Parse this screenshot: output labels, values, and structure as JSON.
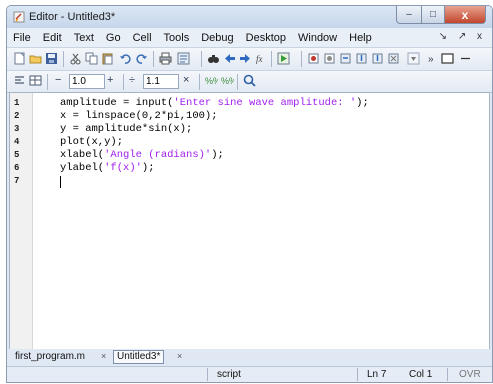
{
  "window": {
    "title": "Editor - Untitled3*",
    "controls": {
      "minimize": "–",
      "maximize": "□",
      "close": "x"
    }
  },
  "menu": {
    "items": [
      "File",
      "Edit",
      "Text",
      "Go",
      "Cell",
      "Tools",
      "Debug",
      "Desktop",
      "Window",
      "Help"
    ],
    "right_controls": "↘ ↗ x"
  },
  "toolbar2": {
    "minus_label": "−",
    "value1": "1.0",
    "plus_label": "+",
    "divide_label": "÷",
    "value2": "1.1",
    "times_label": "×"
  },
  "editor": {
    "line_numbers": [
      "1",
      "2",
      "3",
      "4",
      "5",
      "6",
      "7"
    ],
    "lines": [
      {
        "pre": "amplitude = input(",
        "str": "'Enter sine wave amplitude: '",
        "post": ");"
      },
      {
        "pre": "x = linspace(0,2*pi,100);",
        "str": "",
        "post": ""
      },
      {
        "pre": "y = amplitude*sin(x);",
        "str": "",
        "post": ""
      },
      {
        "pre": "plot(x,y);",
        "str": "",
        "post": ""
      },
      {
        "pre": "xlabel(",
        "str": "'Angle (radians)'",
        "post": ");"
      },
      {
        "pre": "ylabel(",
        "str": "'f(x)'",
        "post": ");"
      },
      {
        "pre": "",
        "str": "",
        "post": ""
      }
    ],
    "cursor_line": 7
  },
  "tabs": [
    {
      "label": "first_program.m",
      "close": "×",
      "active": false
    },
    {
      "label": "Untitled3*",
      "close": "×",
      "active": true
    }
  ],
  "status": {
    "mode": "script",
    "ln": "Ln  7",
    "col": "Col  1",
    "ovr": "OVR"
  },
  "colors": {
    "string": "#a020f0",
    "chrome": "#dfe8f3"
  }
}
